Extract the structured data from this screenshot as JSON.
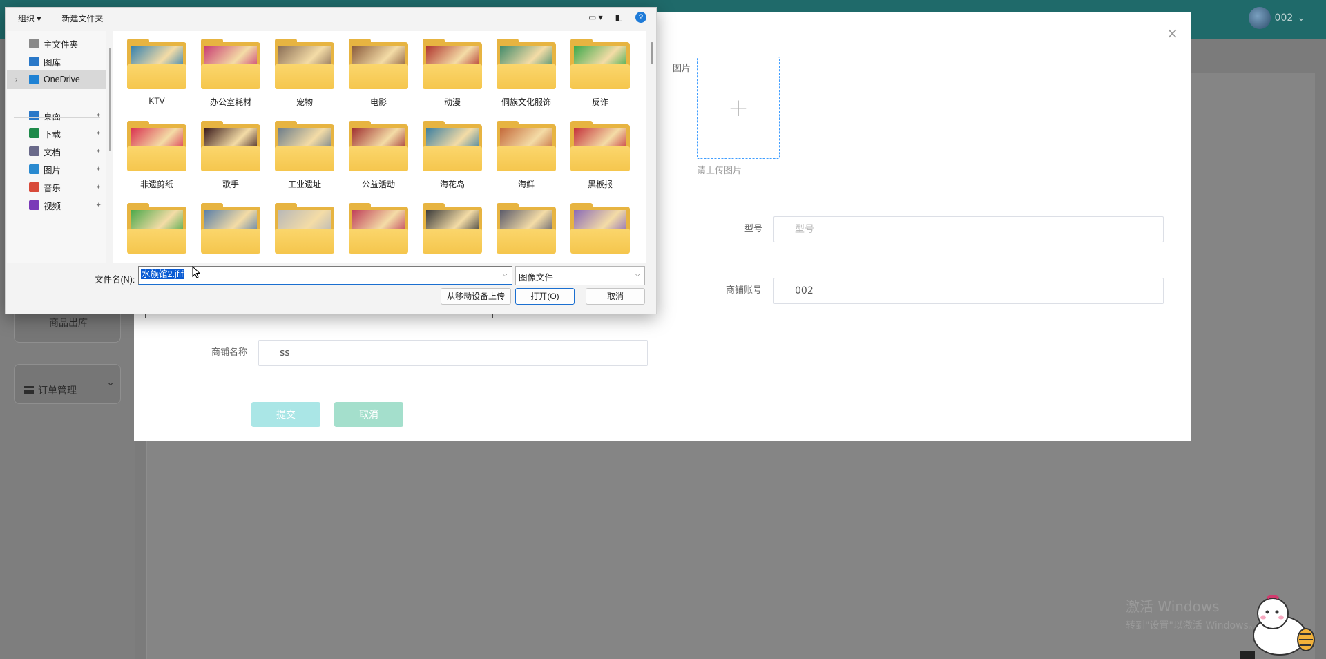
{
  "app": {
    "user_label": "002",
    "menu": {
      "outbound_label": "商品出库",
      "orders_label": "订单管理"
    }
  },
  "modal": {
    "image_label": "图片",
    "upload_plus": "+",
    "upload_hint": "请上传图片",
    "model_label": "型号",
    "model_placeholder": "型号",
    "account_label": "商铺账号",
    "account_value": "002",
    "shop_name_label": "商铺名称",
    "shop_name_value": "ss",
    "submit_label": "提交",
    "cancel_label": "取消",
    "close_glyph": "×"
  },
  "dialog": {
    "toolbar": {
      "organize": "组织 ▾",
      "new_folder": "新建文件夹",
      "help": "?"
    },
    "nav": [
      {
        "label": "主文件夹",
        "icon": "home-icon",
        "pinned": false
      },
      {
        "label": "图库",
        "icon": "gallery-icon",
        "pinned": false
      },
      {
        "label": "OneDrive",
        "icon": "cloud-icon",
        "pinned": false,
        "selected": true
      },
      {
        "label": "桌面",
        "icon": "desktop-icon",
        "pinned": true
      },
      {
        "label": "下载",
        "icon": "download-icon",
        "pinned": true
      },
      {
        "label": "文档",
        "icon": "document-icon",
        "pinned": true
      },
      {
        "label": "图片",
        "icon": "pictures-icon",
        "pinned": true
      },
      {
        "label": "音乐",
        "icon": "music-icon",
        "pinned": true
      },
      {
        "label": "视频",
        "icon": "video-icon",
        "pinned": true
      }
    ],
    "folders": [
      {
        "name": "KTV",
        "thumb": "#2f7fb0"
      },
      {
        "name": "办公室耗材",
        "thumb": "#c93b72"
      },
      {
        "name": "宠物",
        "thumb": "#8a6d55"
      },
      {
        "name": "电影",
        "thumb": "#8a5a3a"
      },
      {
        "name": "动漫",
        "thumb": "#b0322c"
      },
      {
        "name": "侗族文化服饰",
        "thumb": "#3f8a6a"
      },
      {
        "name": "反诈",
        "thumb": "#3aa84a"
      },
      {
        "name": "非遗剪纸",
        "thumb": "#d9304f"
      },
      {
        "name": "歌手",
        "thumb": "#3a1a1a"
      },
      {
        "name": "工业遗址",
        "thumb": "#6d7d8a"
      },
      {
        "name": "公益活动",
        "thumb": "#a03030"
      },
      {
        "name": "海花岛",
        "thumb": "#3a7ea0"
      },
      {
        "name": "海鲜",
        "thumb": "#c4693a"
      },
      {
        "name": "黑板报",
        "thumb": "#c4303a"
      },
      {
        "name": "",
        "thumb": "#4aa84a"
      },
      {
        "name": "",
        "thumb": "#5a7fa8"
      },
      {
        "name": "",
        "thumb": "#b8b8b8"
      },
      {
        "name": "",
        "thumb": "#c0405a"
      },
      {
        "name": "",
        "thumb": "#3a3a3a"
      },
      {
        "name": "",
        "thumb": "#5a5a6a"
      },
      {
        "name": "",
        "thumb": "#8a6ab8"
      }
    ],
    "filename_label": "文件名(N):",
    "filename_value": "水族馆2.jfif",
    "filetype_value": "图像文件",
    "mobile_upload_label": "从移动设备上传",
    "open_label": "打开(O)",
    "cancel_label": "取消"
  },
  "watermark": {
    "line1": "激活 Windows",
    "line2": "转到\"设置\"以激活 Windows。"
  }
}
